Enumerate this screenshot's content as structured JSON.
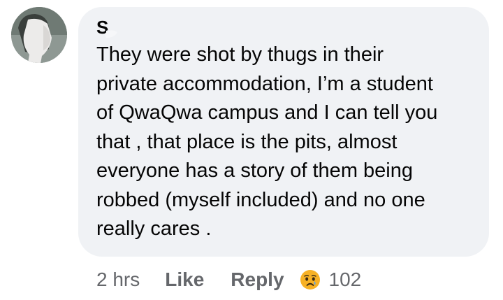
{
  "comment": {
    "author": "S",
    "text": "They were shot by thugs in their\nprivate accommodation, I’m a student\nof QwaQwa campus and I can tell you\nthat , that place is the pits, almost\neveryone has a story of them being\nrobbed (myself included) and no one\nreally cares ."
  },
  "actions": {
    "time": "2 hrs",
    "like_label": "Like",
    "reply_label": "Reply",
    "reaction_icon": "sad-emoji-icon",
    "reaction_count": "102"
  },
  "colors": {
    "bubble_bg": "#f0f2f5",
    "text": "#050505",
    "meta": "#65676b",
    "emoji_face": "#f7b125"
  }
}
